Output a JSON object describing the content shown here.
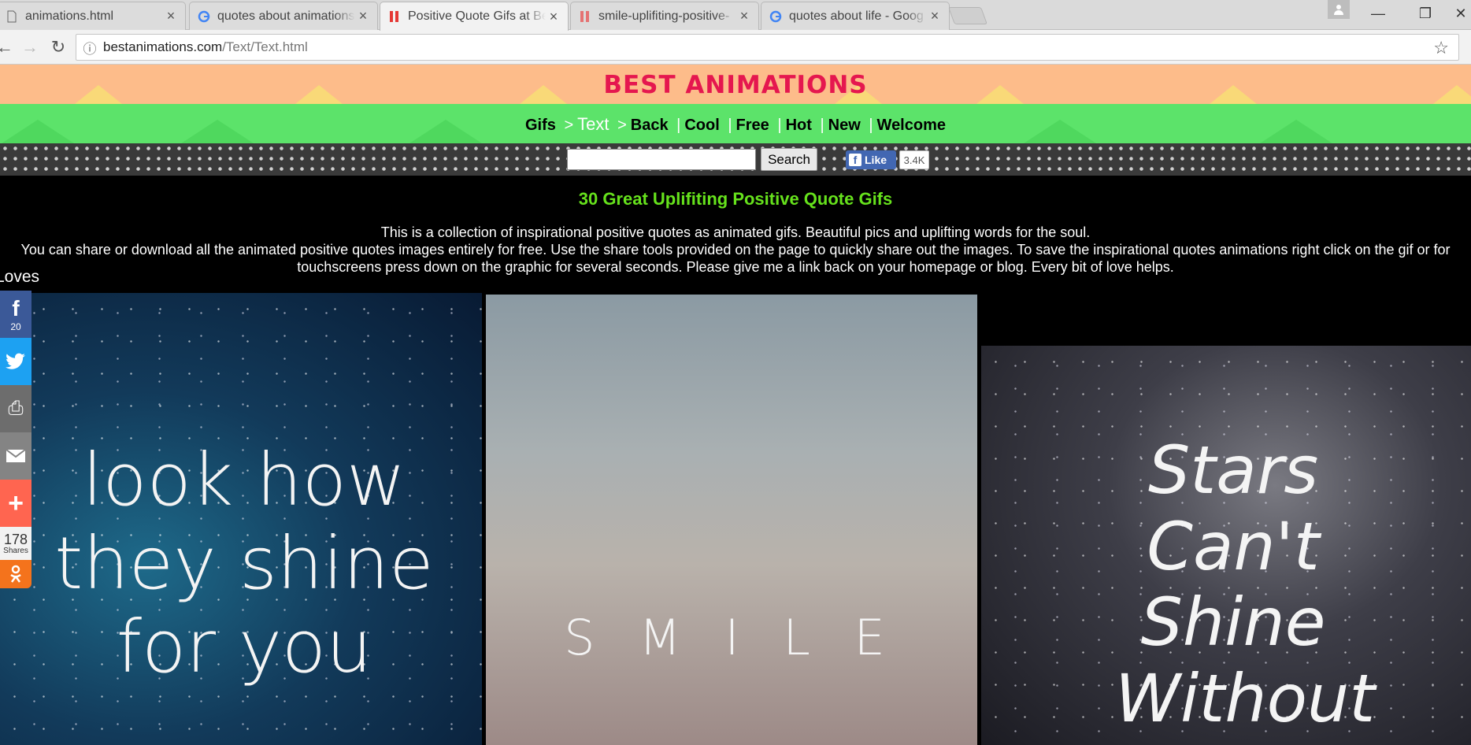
{
  "browser": {
    "tabs": [
      {
        "title": "animations.html"
      },
      {
        "title": "quotes about animations"
      },
      {
        "title": "Positive Quote Gifs at Be"
      },
      {
        "title": "smile-uplifiting-positive-"
      },
      {
        "title": "quotes about life - Goog"
      }
    ],
    "address": {
      "domain": "bestanimations.com",
      "path": "/Text/Text.html"
    }
  },
  "site": {
    "logo": "BEST ANIMATIONS",
    "nav": {
      "gifs": "Gifs",
      "sep1": ">",
      "text": "Text",
      "sep2": ">",
      "back": "Back",
      "cool": "Cool",
      "free": "Free",
      "hot": "Hot",
      "new": "New",
      "welcome": "Welcome",
      "divider": "|"
    },
    "search": {
      "button": "Search"
    },
    "facebook": {
      "like": "Like",
      "count": "3.4K"
    }
  },
  "content": {
    "title": "30 Great Uplifiting Positive Quote Gifs",
    "desc_line1": "This is a collection of inspirational positive quotes as animated gifs. Beautiful pics and uplifting words for the soul.",
    "desc_line2": "You can share or download all the animated positive quotes images entirely for free. Use the share tools provided on the page to quickly share out the images. To save the inspirational quotes animations right click on the gif or for",
    "desc_line3": "touchscreens press down on the graphic for several seconds. Please give me a link back on your homepage or blog. Every bit of love helps.",
    "loves": "Loves"
  },
  "share_bar": {
    "facebook_count": "20",
    "total_count": "178",
    "total_label": "Shares"
  },
  "images": {
    "img1": "look how\nthey shine\nfor you",
    "img2": "S M I L E",
    "img3": "Stars\nCan't\nShine\nWithout"
  }
}
